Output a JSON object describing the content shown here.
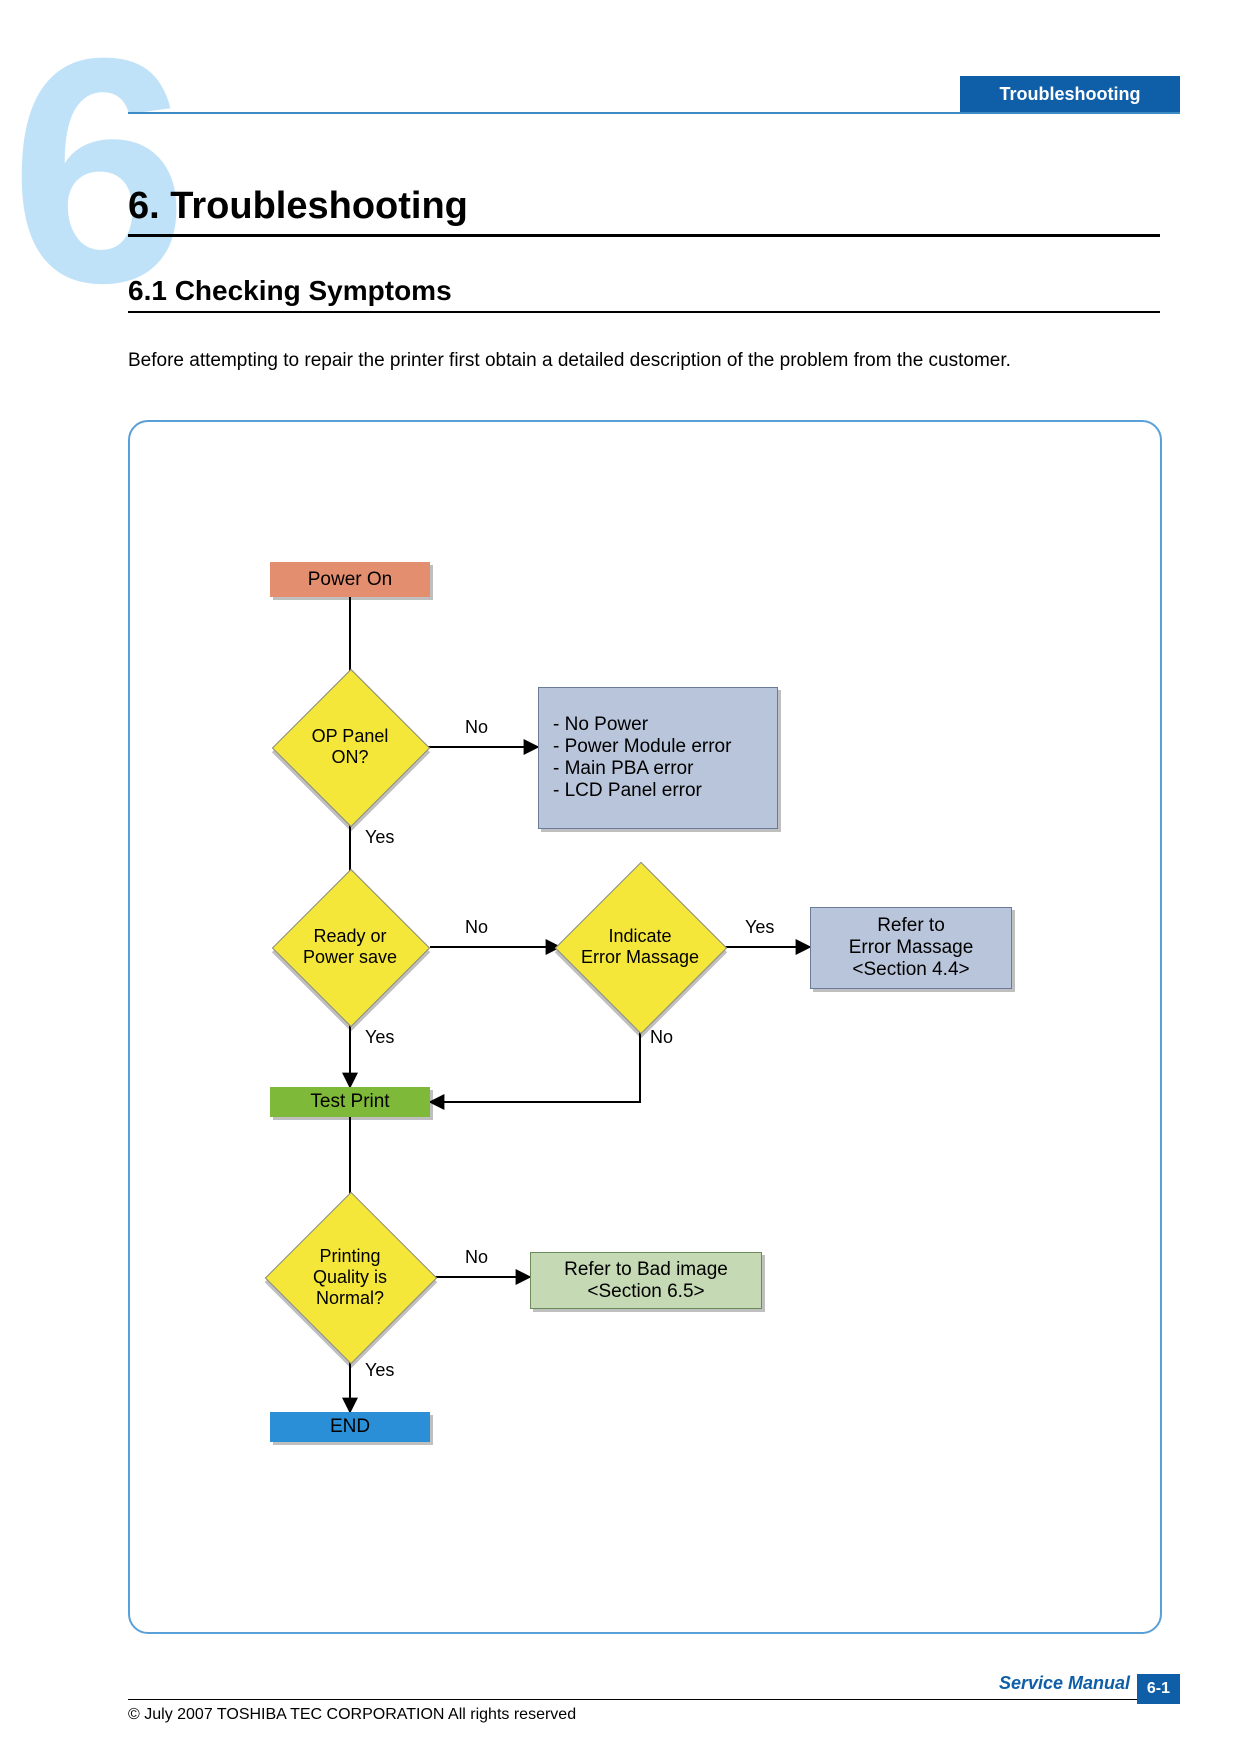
{
  "header": {
    "tab": "Troubleshooting"
  },
  "chapter_glyph": "6",
  "headings": {
    "h1": "6. Troubleshooting",
    "h2": "6.1  Checking Symptoms"
  },
  "intro": "Before attempting to repair the printer first obtain a detailed description of the problem from the customer.",
  "flow": {
    "power_on": "Power On",
    "op_panel": "OP Panel\nON?",
    "ready": "Ready or\nPower save",
    "indicate": "Indicate\nError Massage",
    "test_print": "Test Print",
    "quality": "Printing\nQuality is\nNormal?",
    "end": "END",
    "note_power": "- No Power\n- Power Module error\n- Main PBA error\n- LCD Panel error",
    "note_errmsg": "Refer to\nError Massage\n<Section 4.4>",
    "note_badimg": "Refer to Bad image\n<Section 6.5>",
    "labels": {
      "yes": "Yes",
      "no": "No"
    }
  },
  "footer": {
    "copyright": "© July 2007 TOSHIBA TEC CORPORATION All rights reserved",
    "service": "Service Manual",
    "page": "6-1"
  }
}
